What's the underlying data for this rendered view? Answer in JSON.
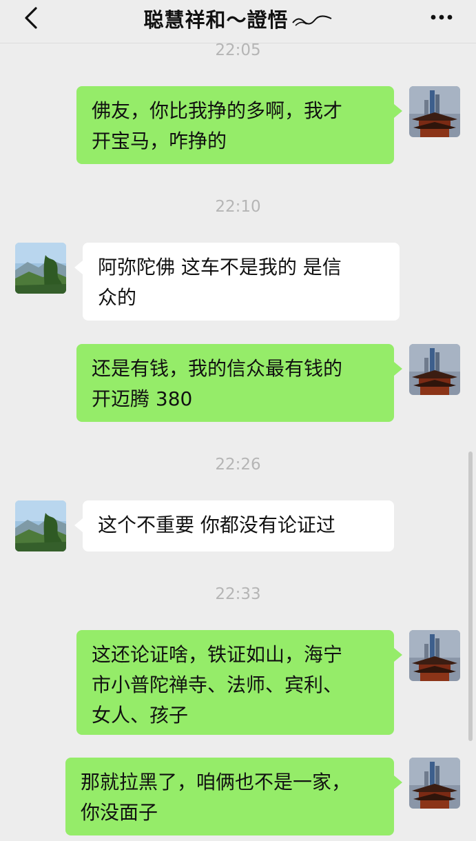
{
  "header": {
    "title": "聪慧祥和～證悟",
    "back_icon": "chevron-left-icon",
    "more_icon": "more-dots-icon"
  },
  "colors": {
    "background": "#ededed",
    "my_bubble": "#95ec69",
    "other_bubble": "#ffffff",
    "timestamp": "#b5b5b5"
  },
  "timestamps": [
    "22:05",
    "22:10",
    "22:26",
    "22:33"
  ],
  "messages": [
    {
      "sender": "me",
      "text": "佛友，你比我挣的多啊，我才\n开宝马，咋挣的"
    },
    {
      "sender": "other",
      "text": "阿弥陀佛  这车不是我的  是信\n众的"
    },
    {
      "sender": "me",
      "text": "还是有钱，我的信众最有钱的\n开迈腾 380"
    },
    {
      "sender": "other",
      "text": "这个不重要   你都没有论证过"
    },
    {
      "sender": "me",
      "text": "这还论证啥，铁证如山，海宁\n市小普陀禅寺、法师、宾利、\n女人、孩子"
    },
    {
      "sender": "me",
      "text": "那就拉黑了，咱俩也不是一家，\n你没面子"
    }
  ],
  "avatars": {
    "me": "temple-tower-avatar",
    "other": "mountain-landscape-avatar"
  }
}
